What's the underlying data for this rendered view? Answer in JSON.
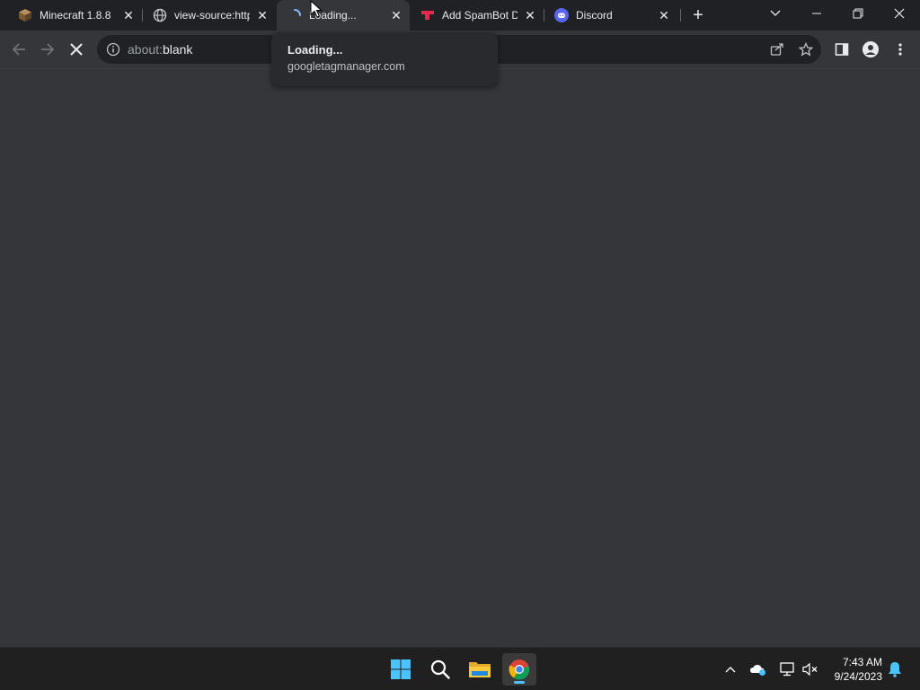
{
  "tabs": [
    {
      "title": "Minecraft 1.8.8",
      "favicon": "minecraft-block-icon"
    },
    {
      "title": "view-source:http",
      "favicon": "globe-icon"
    },
    {
      "title": "Loading...",
      "favicon": "loading-spinner-icon",
      "active": true
    },
    {
      "title": "Add SpamBot D",
      "favicon": "spambot-logo-icon"
    },
    {
      "title": "Discord",
      "favicon": "discord-icon"
    }
  ],
  "address_bar": {
    "scheme": "about:",
    "host": "blank"
  },
  "hover_card": {
    "title": "Loading...",
    "domain": "googletagmanager.com"
  },
  "taskbar": {
    "time": "7:43 AM",
    "date": "9/24/2023"
  },
  "colors": {
    "accent": "#4cc2ff",
    "discord": "#5865f2",
    "spambot": "#e8264f"
  }
}
